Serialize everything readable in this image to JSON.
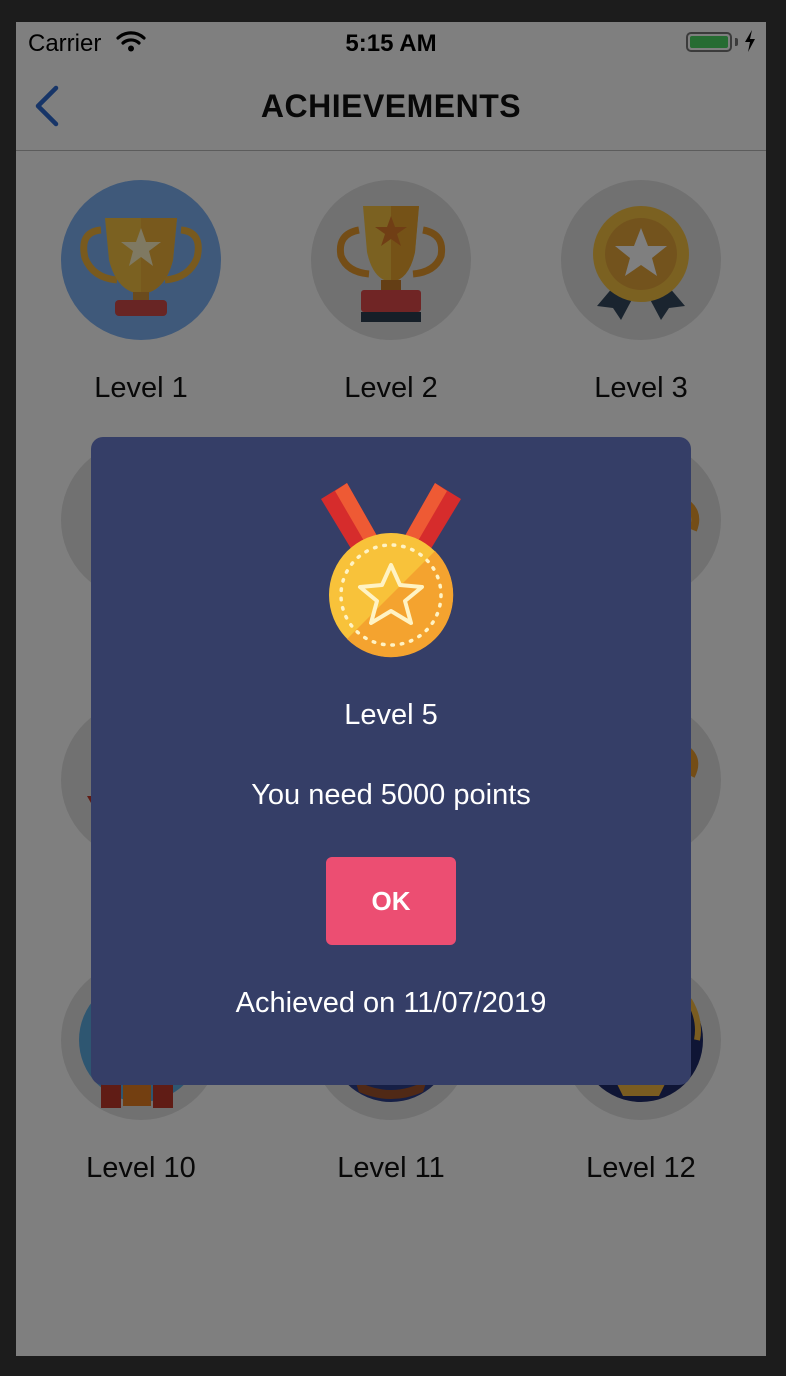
{
  "status_bar": {
    "carrier": "Carrier",
    "time": "5:15 AM"
  },
  "nav": {
    "title": "ACHIEVEMENTS",
    "back_icon": "chevron-left-icon"
  },
  "colors": {
    "accent": "#2f6bd0",
    "modal_bg": "#353e67",
    "ok_button": "#ec4e72",
    "active_badge_bg": "#7fb3f5",
    "battery": "#4cd964"
  },
  "levels": [
    {
      "label": "Level 1",
      "icon": "trophy-icon"
    },
    {
      "label": "Level 2",
      "icon": "trophy-icon"
    },
    {
      "label": "Level 3",
      "icon": "rosette-medal-icon"
    },
    {
      "label": "Level 10",
      "icon": "badge-icon"
    },
    {
      "label": "Level 11",
      "icon": "badge-icon"
    },
    {
      "label": "Level 12",
      "icon": "badge-icon"
    }
  ],
  "modal": {
    "icon": "gold-medal-icon",
    "level": "Level 5",
    "requirement": "You need 5000 points",
    "ok_label": "OK",
    "achieved": "Achieved on 11/07/2019"
  }
}
